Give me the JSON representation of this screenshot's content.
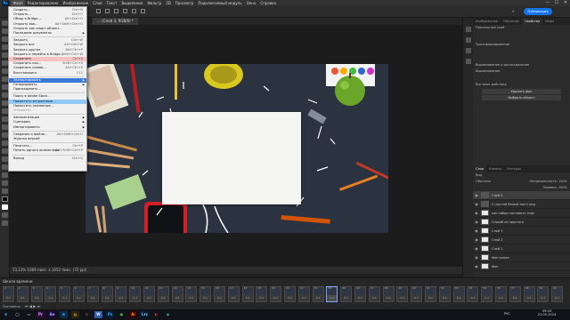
{
  "app": {
    "logo": "Ps",
    "window_min": "—",
    "window_max": "☐",
    "window_close": "✕"
  },
  "menu": [
    "Файл",
    "Редактирование",
    "Изображение",
    "Слои",
    "Текст",
    "Выделение",
    "Фильтр",
    "3D",
    "Просмотр",
    "Подключаемый модуль",
    "Окно",
    "Справка"
  ],
  "optbar_button": "Публикация",
  "document": {
    "tab": "… (Слой 4, RGB/8) *",
    "status": "73,13%   1669 пикс. x 1052 пикс. (72 ppi)"
  },
  "file_menu": [
    {
      "label": "Создать...",
      "sc": "Ctrl+N"
    },
    {
      "label": "Открыть...",
      "sc": "Ctrl+O"
    },
    {
      "label": "Обзор в Bridge...",
      "sc": "Alt+Ctrl+O"
    },
    {
      "label": "Открыть как...",
      "sc": "Alt+Shift+Ctrl+O"
    },
    {
      "label": "Открыть как смарт-объект...",
      "sc": ""
    },
    {
      "label": "Последние документы",
      "sc": "",
      "arrow": true
    },
    {
      "sep": true
    },
    {
      "label": "Закрыть",
      "sc": "Ctrl+W"
    },
    {
      "label": "Закрыть все",
      "sc": "Alt+Ctrl+W"
    },
    {
      "label": "Закрыть другие",
      "sc": "Alt+Ctrl+P"
    },
    {
      "label": "Закрыть и перейти в Bridge...",
      "sc": "Shift+Ctrl+W"
    },
    {
      "label": "Сохранить",
      "sc": "Ctrl+S",
      "hl": "hl2"
    },
    {
      "label": "Сохранить как...",
      "sc": "Shift+Ctrl+S"
    },
    {
      "label": "Сохранить копию...",
      "sc": "Alt+Ctrl+S"
    },
    {
      "label": "Восстановить",
      "sc": "F12"
    },
    {
      "sep": true
    },
    {
      "label": "Экспортировать",
      "sc": "",
      "arrow": true,
      "hl": "hl3"
    },
    {
      "label": "Генерировать",
      "sc": "",
      "arrow": true
    },
    {
      "label": "Присоединить...",
      "sc": ""
    },
    {
      "sep": true
    },
    {
      "label": "Поиск в Adobe Stock...",
      "sc": ""
    },
    {
      "label": "Поместить встроенные...",
      "sc": "",
      "hl": "hl"
    },
    {
      "label": "Поместить связанные...",
      "sc": ""
    },
    {
      "label": "Упаковать...",
      "sc": "",
      "dis": true
    },
    {
      "sep": true
    },
    {
      "label": "Автоматизация",
      "sc": "",
      "arrow": true
    },
    {
      "label": "Сценарии",
      "sc": "",
      "arrow": true
    },
    {
      "label": "Импортировать",
      "sc": "",
      "arrow": true
    },
    {
      "sep": true
    },
    {
      "label": "Сведения о файле...",
      "sc": "Alt+Shift+Ctrl+I"
    },
    {
      "label": "Журнал версий",
      "sc": ""
    },
    {
      "sep": true
    },
    {
      "label": "Печатать...",
      "sc": "Ctrl+P"
    },
    {
      "label": "Печать одного экземпляра",
      "sc": "Alt+Shift+Ctrl+P"
    },
    {
      "sep": true
    },
    {
      "label": "Выход",
      "sc": "Ctrl+Q"
    }
  ],
  "panel_top": {
    "tabs": [
      "Изображения",
      "Обучение",
      "Свойства",
      "Инфо"
    ],
    "rows": [
      "Пиксельный слой",
      "Трансформирование",
      "Выравнивание и распределение",
      "Выравнивание:",
      "Быстрые действия"
    ],
    "buttons": [
      "Удалить фон",
      "Выбрать объект"
    ]
  },
  "panel_layers": {
    "tabs": [
      "Слои",
      "Каналы",
      "Контуры"
    ],
    "search": "Вид",
    "blend": "Обычные",
    "opacity": "Непрозрачность: 100%",
    "fill": "Заливка: 100%",
    "items": [
      {
        "name": "Слой 4",
        "sel": true,
        "dark": true
      },
      {
        "name": "2 (пустой белый лист) png",
        "dark": true
      },
      {
        "name": "как набор поставить знак",
        "dark": false
      },
      {
        "name": "Способ из простого",
        "dark": false
      },
      {
        "name": "Слой 3",
        "dark": false
      },
      {
        "name": "Слой 2",
        "dark": false
      },
      {
        "name": "Слой 1",
        "dark": false
      },
      {
        "name": "Фон копия",
        "dark": false
      },
      {
        "name": "Фон",
        "dark": false
      }
    ]
  },
  "timeline": {
    "title": "Шкала времени",
    "frames": [
      {
        "n": "1",
        "t": "0,1"
      },
      {
        "n": "2",
        "t": "0,1"
      },
      {
        "n": "3",
        "t": "0,1"
      },
      {
        "n": "4",
        "t": "0,1"
      },
      {
        "n": "5",
        "t": "0,1"
      },
      {
        "n": "6",
        "t": "0,1"
      },
      {
        "n": "7",
        "t": "0,1"
      },
      {
        "n": "8",
        "t": "0,1"
      },
      {
        "n": "9",
        "t": "0,1"
      },
      {
        "n": "10",
        "t": "0,1"
      },
      {
        "n": "11",
        "t": "0,1"
      },
      {
        "n": "12",
        "t": "0,1"
      },
      {
        "n": "13",
        "t": "0,1"
      },
      {
        "n": "14",
        "t": "0,1"
      },
      {
        "n": "15",
        "t": "0,1"
      },
      {
        "n": "16",
        "t": "0,1"
      },
      {
        "n": "17",
        "t": "0,1"
      },
      {
        "n": "18",
        "t": "0,1"
      },
      {
        "n": "19",
        "t": "0,1"
      },
      {
        "n": "20",
        "t": "0,1"
      },
      {
        "n": "21",
        "t": "0,1"
      },
      {
        "n": "22",
        "t": "0,1"
      },
      {
        "n": "23",
        "t": "0,1"
      },
      {
        "n": "24",
        "t": "0,1",
        "sel": true
      },
      {
        "n": "25",
        "t": "0,1"
      },
      {
        "n": "26",
        "t": "0,1"
      },
      {
        "n": "27",
        "t": "0,1"
      },
      {
        "n": "28",
        "t": "0,1"
      },
      {
        "n": "29",
        "t": "0,1"
      },
      {
        "n": "30",
        "t": "0,1"
      },
      {
        "n": "31",
        "t": "0,1"
      },
      {
        "n": "32",
        "t": "0,1"
      },
      {
        "n": "33",
        "t": "0,1"
      },
      {
        "n": "34",
        "t": "0,1"
      },
      {
        "n": "35",
        "t": "0,1"
      },
      {
        "n": "36",
        "t": "0,1"
      },
      {
        "n": "37",
        "t": "0,1"
      },
      {
        "n": "38",
        "t": "0,1"
      },
      {
        "n": "39",
        "t": "0,1"
      },
      {
        "n": "40",
        "t": "0,1"
      }
    ],
    "loop": "Постоянно"
  },
  "taskbar": {
    "apps": [
      {
        "label": "⊞",
        "color": "#3aa0ff",
        "bg": "#111319"
      },
      {
        "label": "◯",
        "color": "#ddd",
        "bg": "#111319"
      },
      {
        "label": "▭",
        "color": "#ddd",
        "bg": "#111319"
      },
      {
        "label": "Pr",
        "color": "#e9a1ff",
        "bg": "#2a0a3a"
      },
      {
        "label": "Ae",
        "color": "#b9a6ff",
        "bg": "#1a0a3a"
      },
      {
        "label": "e",
        "color": "#3ecbff",
        "bg": "#0b2a4a"
      },
      {
        "label": "▤",
        "color": "#f6c64a",
        "bg": "#2a2410"
      },
      {
        "label": "⬡",
        "color": "#f97",
        "bg": "#111319"
      },
      {
        "label": "W",
        "color": "#fff",
        "bg": "#2b5fb3"
      },
      {
        "label": "Ps",
        "color": "#31a8ff",
        "bg": "#001e36"
      },
      {
        "label": "●",
        "color": "#4caf50",
        "bg": "#111319"
      },
      {
        "label": "Ai",
        "color": "#ff9a00",
        "bg": "#330000"
      },
      {
        "label": "Lrc",
        "color": "#8fd2ff",
        "bg": "#001a2e"
      },
      {
        "label": "◐",
        "color": "#e44",
        "bg": "#111319"
      },
      {
        "label": "◉",
        "color": "#3b8",
        "bg": "#111319"
      }
    ],
    "time": "09:43",
    "date": "21.05.2024",
    "lang": "РУС"
  }
}
